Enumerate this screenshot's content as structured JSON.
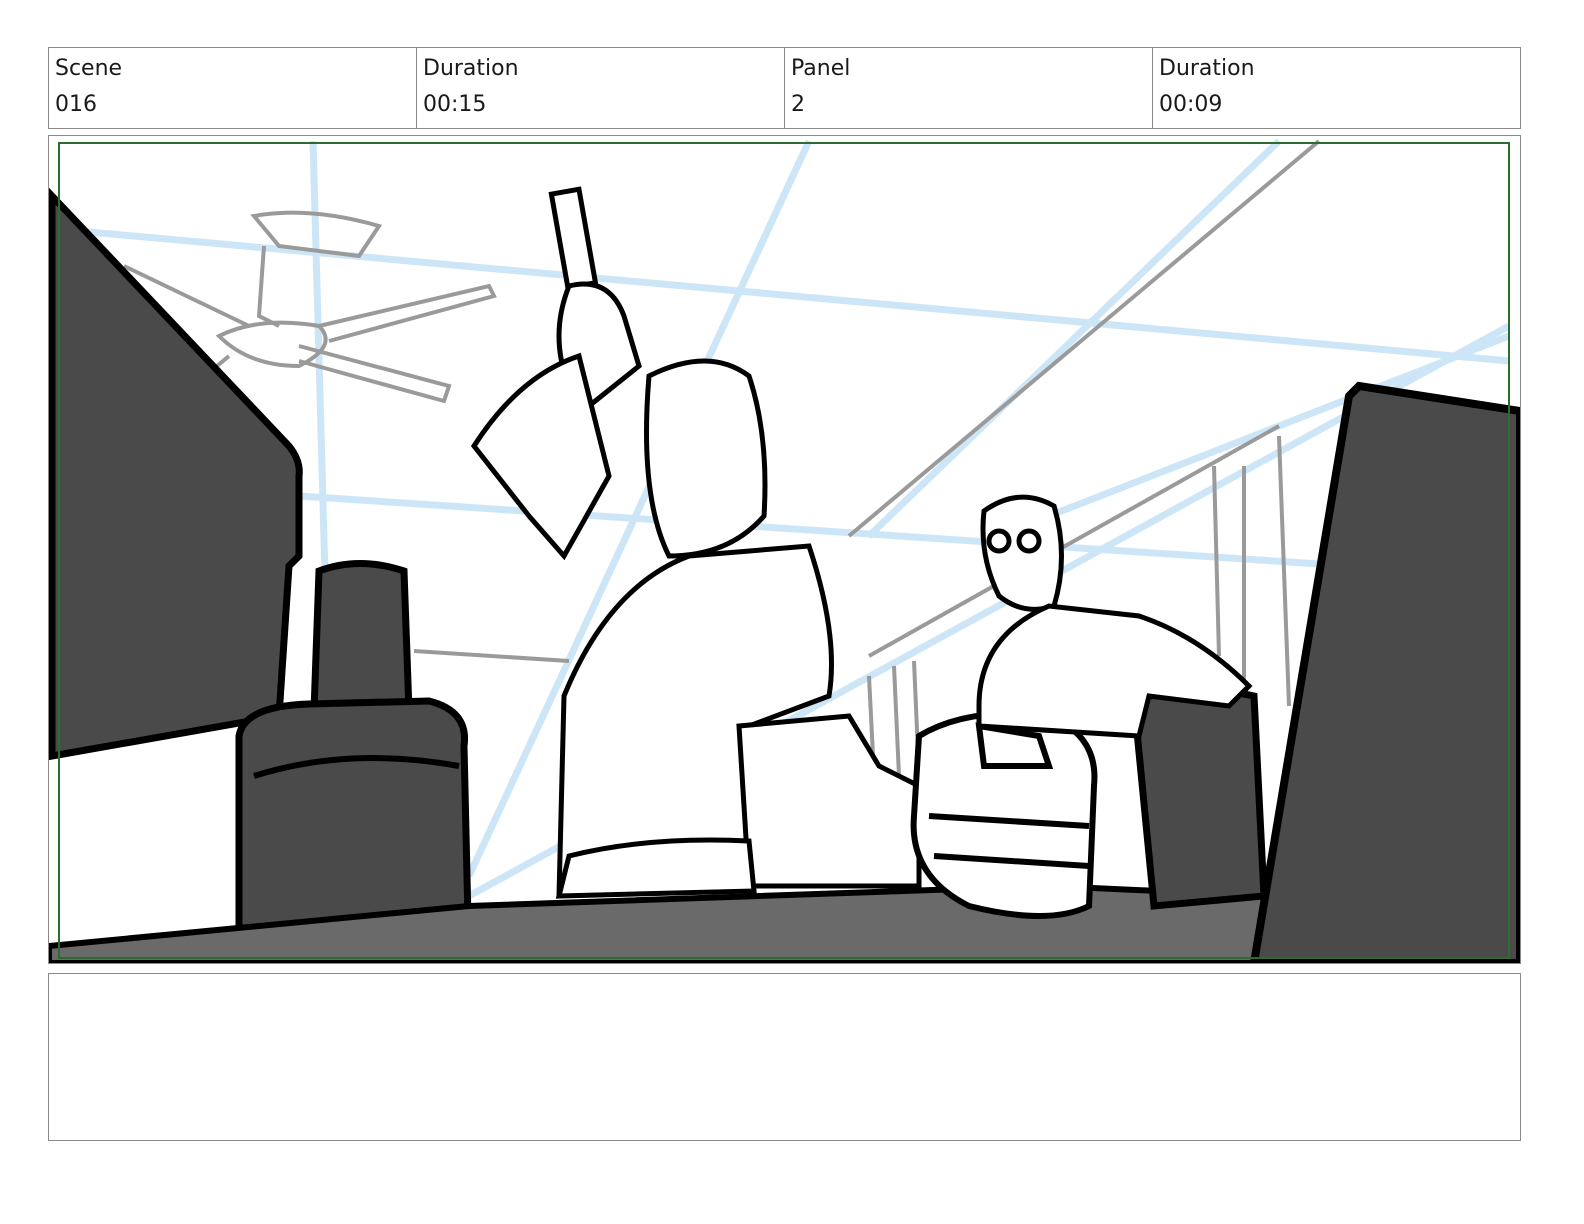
{
  "header": {
    "scene_label": "Scene",
    "scene_value": "016",
    "scene_duration_label": "Duration",
    "scene_duration_value": "00:15",
    "panel_label": "Panel",
    "panel_value": "2",
    "panel_duration_label": "Duration",
    "panel_duration_value": "00:09"
  },
  "notes": {
    "text": ""
  },
  "colors": {
    "guide_blue": "#cde6f7",
    "safe_frame_green": "#2e6b2e",
    "prop_dark": "#4a4a4a",
    "desk_gray": "#6a6a6a",
    "sketch_gray": "#9a9a9a"
  },
  "icons": [
    "storyboard-sketch-image"
  ]
}
